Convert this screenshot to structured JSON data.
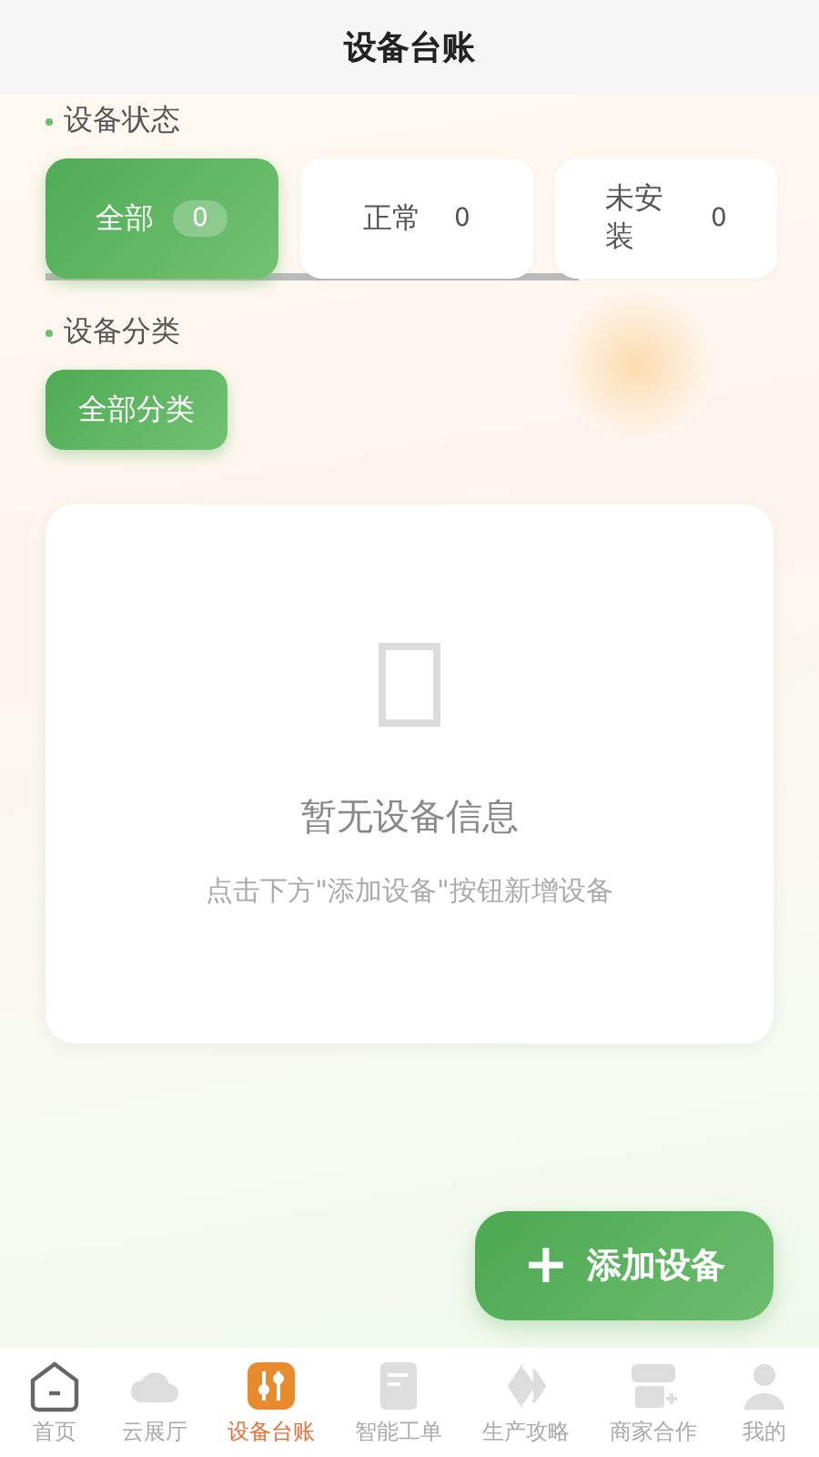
{
  "header": {
    "title": "设备台账"
  },
  "status_section": {
    "label": "设备状态",
    "chips": [
      {
        "label": "全部",
        "count": "0",
        "selected": true
      },
      {
        "label": "正常",
        "count": "0",
        "selected": false
      },
      {
        "label": "未安装",
        "count": "0",
        "selected": false
      }
    ]
  },
  "category_section": {
    "label": "设备分类",
    "chips": [
      {
        "label": "全部分类",
        "selected": true
      }
    ]
  },
  "empty_state": {
    "title": "暂无设备信息",
    "hint": "点击下方\"添加设备\"按钮新增设备"
  },
  "add_button": {
    "icon": "+",
    "label": "添加设备"
  },
  "tab_bar": [
    {
      "kind": "home",
      "label": "首页",
      "selected": false
    },
    {
      "kind": "cloud",
      "label": "云展厅",
      "selected": false
    },
    {
      "kind": "sliders",
      "label": "设备台账",
      "selected": true
    },
    {
      "kind": "form",
      "label": "智能工单",
      "selected": false
    },
    {
      "kind": "chevrons",
      "label": "生产攻略",
      "selected": false
    },
    {
      "kind": "store",
      "label": "商家合作",
      "selected": false
    },
    {
      "kind": "user",
      "label": "我的",
      "selected": false
    }
  ]
}
